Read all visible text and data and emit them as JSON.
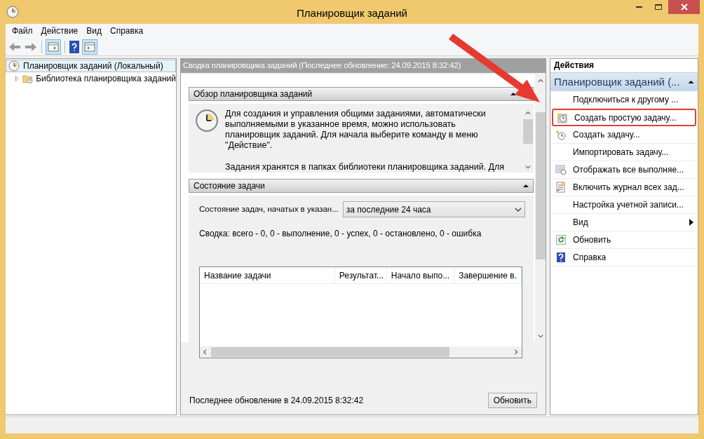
{
  "window": {
    "title": "Планировщик заданий"
  },
  "menu": [
    {
      "label": "Файл"
    },
    {
      "label": "Действие"
    },
    {
      "label": "Вид"
    },
    {
      "label": "Справка"
    }
  ],
  "tree": [
    {
      "label": "Планировщик заданий (Локальный)",
      "selected": true,
      "children": [
        {
          "label": "Библиотека планировщика заданий",
          "selected": false,
          "expanded": false
        }
      ]
    }
  ],
  "summary": {
    "header": "Сводка планировщика заданий (Последнее обновление: 24.09.2015 8:32:42)",
    "overview": {
      "title": "Обзор планировщика заданий",
      "expanded": true,
      "paragraphs": [
        "Для создания и управления общими заданиями, автоматически выполняемыми в указанное время, можно использовать планировщик заданий. Для начала выберите команду в меню \"Действие\".",
        "Задания хранятся в папках библиотеки планировщика заданий. Для"
      ]
    },
    "task_status": {
      "title": "Состояние задачи",
      "expanded": true,
      "filter_label": "Состояние задач, начатых в указан...",
      "filter_value": "за последние 24 часа",
      "totals": "Сводка: всего - 0, 0 - выполнение, 0 - успех, 0 - остановлено, 0 - ошибка",
      "columns": [
        "Название задачи",
        "Результат...",
        "Начало выпо...",
        "Завершение в."
      ]
    },
    "last_update": "Последнее обновление в 24.09.2015 8:32:42",
    "refresh_button": "Обновить"
  },
  "actions": {
    "title": "Действия",
    "group": "Планировщик заданий (...",
    "items": [
      {
        "label": "Подключиться к другому ...",
        "highlighted": false,
        "submenu": false
      },
      {
        "label": "Создать простую задачу...",
        "highlighted": true,
        "submenu": false
      },
      {
        "label": "Создать задачу...",
        "highlighted": false,
        "submenu": false
      },
      {
        "label": "Импортировать задачу...",
        "highlighted": false,
        "submenu": false
      },
      {
        "label": "Отображать все выполняе...",
        "highlighted": false,
        "submenu": false
      },
      {
        "label": "Включить журнал всех зад...",
        "highlighted": false,
        "submenu": false
      },
      {
        "label": "Настройка учетной записи...",
        "highlighted": false,
        "submenu": false
      },
      {
        "label": "Вид",
        "highlighted": false,
        "submenu": true
      },
      {
        "label": "Обновить",
        "highlighted": false,
        "submenu": false
      },
      {
        "label": "Справка",
        "highlighted": false,
        "submenu": false
      }
    ]
  }
}
